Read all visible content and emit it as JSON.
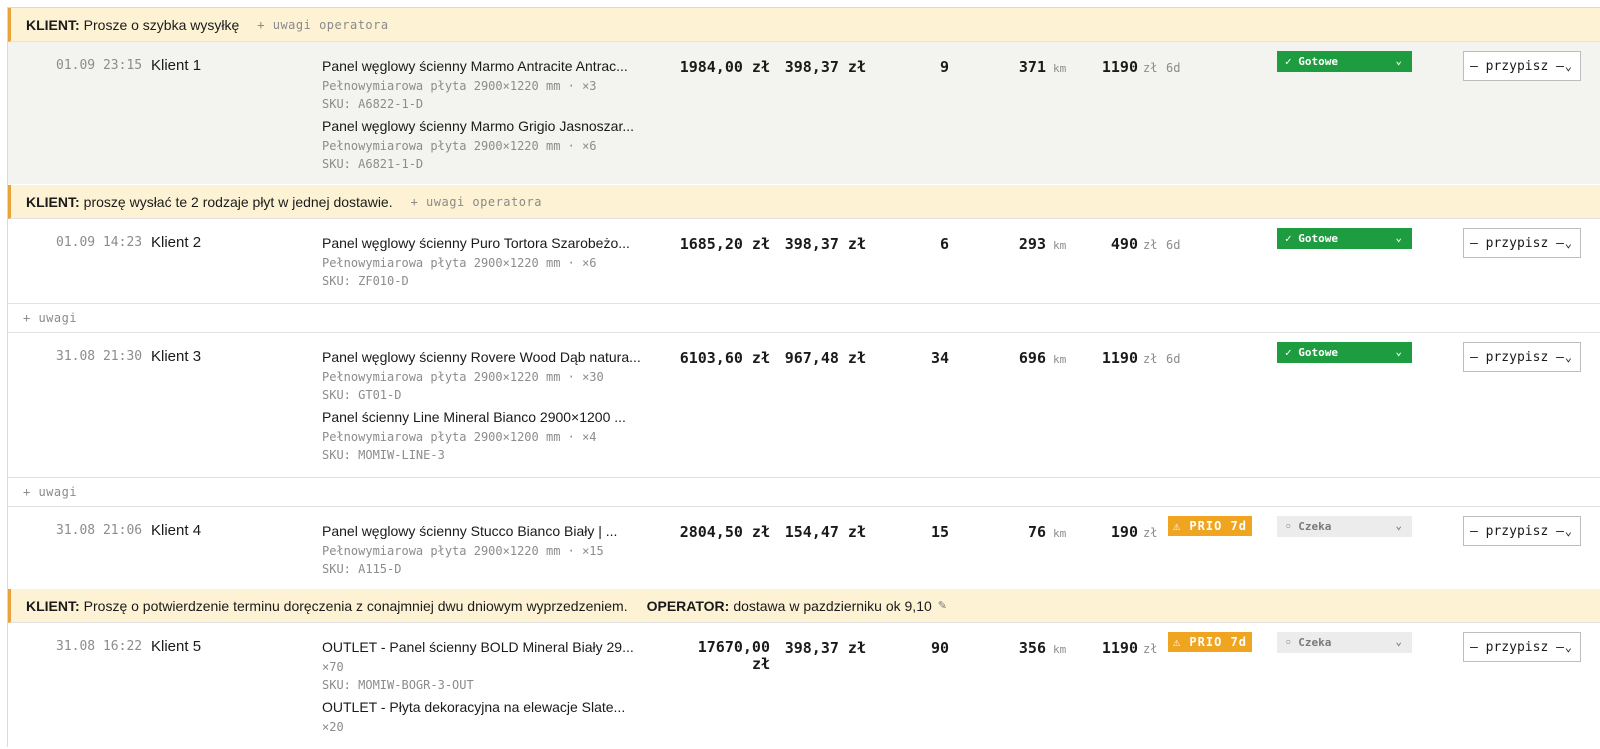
{
  "strings": {
    "client_label": "KLIENT:",
    "operator_label": "OPERATOR:",
    "add_operator_note": "+ uwagi operatora",
    "add_note": "+ uwagi",
    "currency": "zł",
    "km_unit": "km",
    "assign_placeholder": "— przypisz —",
    "chevron": "⌄"
  },
  "orders": [
    {
      "note": {
        "client": "Prosze o szybka wysyłkę",
        "operator": null,
        "show_add_operator": true
      },
      "date": "01.09 23:15",
      "client": "Klient 1",
      "items": [
        {
          "name": "Panel węglowy ścienny Marmo Antracite Antrac...",
          "meta": "Pełnowymiarowa płyta 2900×1220 mm · ×3",
          "sku": "SKU: A6822-1-D"
        },
        {
          "name": "Panel węglowy ścienny Marmo Grigio Jasnoszar...",
          "meta": "Pełnowymiarowa płyta 2900×1220 mm · ×6",
          "sku": "SKU: A6821-1-D"
        }
      ],
      "gross": "1984,00 zł",
      "net": "398,37 zł",
      "qty": "9",
      "distance": "371",
      "shipping": "1190",
      "lead": "6d",
      "prio": null,
      "status": {
        "label": "✓ Gotowe",
        "kind": "ok"
      },
      "selected": true
    },
    {
      "note": {
        "client": "proszę wysłać te 2 rodzaje płyt w jednej dostawie.",
        "operator": null,
        "show_add_operator": true
      },
      "date": "01.09 14:23",
      "client": "Klient 2",
      "items": [
        {
          "name": "Panel węglowy ścienny Puro Tortora Szarobeżo...",
          "meta": "Pełnowymiarowa płyta 2900×1220 mm · ×6",
          "sku": "SKU: ZF010-D"
        }
      ],
      "gross": "1685,20 zł",
      "net": "398,37 zł",
      "qty": "6",
      "distance": "293",
      "shipping": "490",
      "lead": "6d",
      "prio": null,
      "status": {
        "label": "✓ Gotowe",
        "kind": "ok"
      },
      "selected": false
    },
    {
      "note": null,
      "date": "31.08 21:30",
      "client": "Klient 3",
      "items": [
        {
          "name": "Panel węglowy ścienny Rovere Wood Dąb natura...",
          "meta": "Pełnowymiarowa płyta 2900×1220 mm · ×30",
          "sku": "SKU: GT01-D"
        },
        {
          "name": "Panel ścienny Line Mineral Bianco 2900×1200 ...",
          "meta": "Pełnowymiarowa płyta 2900×1200 mm · ×4",
          "sku": "SKU: MOMIW-LINE-3"
        }
      ],
      "gross": "6103,60 zł",
      "net": "967,48 zł",
      "qty": "34",
      "distance": "696",
      "shipping": "1190",
      "lead": "6d",
      "prio": null,
      "status": {
        "label": "✓ Gotowe",
        "kind": "ok"
      },
      "selected": false
    },
    {
      "note": null,
      "date": "31.08 21:06",
      "client": "Klient 4",
      "items": [
        {
          "name": "Panel węglowy ścienny Stucco Bianco Biały | ...",
          "meta": "Pełnowymiarowa płyta 2900×1220 mm · ×15",
          "sku": "SKU: A115-D"
        }
      ],
      "gross": "2804,50 zł",
      "net": "154,47 zł",
      "qty": "15",
      "distance": "76",
      "shipping": "190",
      "lead": null,
      "prio": "⚠ PRIO 7d",
      "status": {
        "label": "◦ Czeka",
        "kind": "wait"
      },
      "selected": false
    },
    {
      "note": {
        "client": "Proszę o potwierdzenie terminu doręczenia z conajmniej dwu dniowym wyprzedzeniem.",
        "operator": "dostawa w pazdzierniku ok 9,10",
        "show_add_operator": false
      },
      "date": "31.08 16:22",
      "client": "Klient 5",
      "items": [
        {
          "name": "OUTLET - Panel ścienny BOLD Mineral Biały 29...",
          "meta": "×70",
          "sku": "SKU: MOMIW-BOGR-3-OUT"
        },
        {
          "name": "OUTLET - Płyta dekoracyjna na elewacje Slate...",
          "meta": "×20",
          "sku": ""
        }
      ],
      "gross_line1": "17670,00",
      "gross_line2": "zł",
      "net": "398,37 zł",
      "qty": "90",
      "distance": "356",
      "shipping": "1190",
      "lead": null,
      "prio": "⚠ PRIO 7d",
      "status": {
        "label": "◦ Czeka",
        "kind": "wait"
      },
      "selected": false
    }
  ]
}
